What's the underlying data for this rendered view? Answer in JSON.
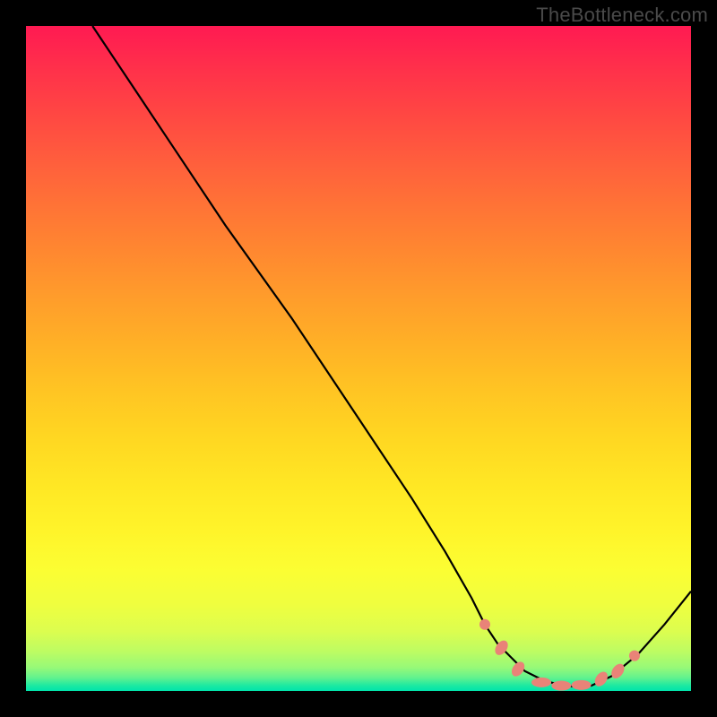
{
  "watermark": "TheBottleneck.com",
  "chart_data": {
    "type": "line",
    "title": "",
    "xlabel": "",
    "ylabel": "",
    "xlim": [
      0,
      100
    ],
    "ylim": [
      0,
      100
    ],
    "series": [
      {
        "name": "curve",
        "x": [
          10,
          12,
          16,
          22,
          30,
          40,
          50,
          58,
          63,
          67,
          69,
          71,
          73,
          75,
          78,
          81,
          83,
          85,
          88,
          92,
          96,
          100
        ],
        "values": [
          100,
          97,
          91,
          82,
          70,
          56,
          41,
          29,
          21,
          14,
          10,
          7,
          5,
          3,
          1.5,
          0.8,
          0.6,
          0.8,
          2.2,
          5.5,
          10,
          15
        ]
      }
    ],
    "markers": [
      {
        "x": 69,
        "y": 10,
        "type": "dot"
      },
      {
        "x": 71.5,
        "y": 6.5,
        "type": "oval"
      },
      {
        "x": 74,
        "y": 3.3,
        "type": "oval"
      },
      {
        "x": 77.5,
        "y": 1.3,
        "type": "lozenge"
      },
      {
        "x": 80.5,
        "y": 0.8,
        "type": "lozenge"
      },
      {
        "x": 83.5,
        "y": 0.9,
        "type": "lozenge"
      },
      {
        "x": 86.5,
        "y": 1.8,
        "type": "oval"
      },
      {
        "x": 89,
        "y": 3.0,
        "type": "oval"
      },
      {
        "x": 91.5,
        "y": 5.3,
        "type": "dot"
      }
    ],
    "colors": {
      "curve": "#000000",
      "marker_fill": "#e98378",
      "background_top": "#ff1a52",
      "background_bottom": "#00e4ab"
    }
  }
}
